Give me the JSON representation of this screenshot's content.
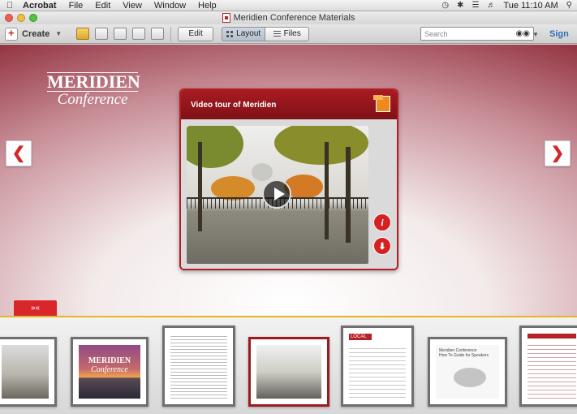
{
  "menubar": {
    "items": [
      "Acrobat",
      "File",
      "Edit",
      "View",
      "Window",
      "Help"
    ],
    "clock": "Tue 11:10 AM"
  },
  "window": {
    "title": "Meridien Conference Materials"
  },
  "toolbar": {
    "create_label": "Create",
    "edit_label": "Edit",
    "layout_label": "Layout",
    "files_label": "Files",
    "search_placeholder": "Search",
    "sign_label": "Sign"
  },
  "logo": {
    "line1": "MERIDIEN",
    "line2": "Conference"
  },
  "card": {
    "title": "Video tour of Meridien"
  },
  "strip": {
    "toggle_label": "»«",
    "selected_index": 3,
    "thumbnails": [
      {
        "kind": "bike-photo"
      },
      {
        "kind": "city-cover",
        "line1": "MERIDIEN",
        "line2": "Conference"
      },
      {
        "kind": "document"
      },
      {
        "kind": "video-still"
      },
      {
        "kind": "form",
        "header": "LOCAL"
      },
      {
        "kind": "speaker-guide",
        "line1": "Meridien Conference",
        "line2": "How To Guide for Speakers"
      },
      {
        "kind": "schedule"
      }
    ]
  },
  "colors": {
    "accent_red": "#d12a2a",
    "brand_maroon": "#8f2d3b",
    "strip_divider": "#e7b423",
    "sign_blue": "#2a6fb8"
  }
}
